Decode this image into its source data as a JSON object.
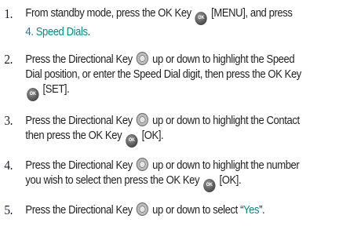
{
  "steps": [
    {
      "num": "1.",
      "line1_a": "From standby mode, press the OK Key",
      "line1_b": "[MENU], and press",
      "line2_link": "4. Speed Dials",
      "line2_end": "."
    },
    {
      "num": "2.",
      "line1_a": "Press the Directional Key",
      "line1_b": "up or down to highlight the Speed",
      "line2": "Dial position, or enter the Speed Dial digit, then press the OK Key",
      "line3": "[SET]."
    },
    {
      "num": "3.",
      "line1_a": "Press the Directional Key",
      "line1_b": "up or down to highlight the Contact",
      "line2_a": "then press the OK Key",
      "line2_b": "[OK]."
    },
    {
      "num": "4.",
      "line1_a": "Press the Directional Key",
      "line1_b": "up or down to highlight the number",
      "line2_a": "you wish to select then press the OK Key",
      "line2_b": "[OK]."
    },
    {
      "num": "5.",
      "line1_a": "Press the Directional Key",
      "line1_b": "up or down to select “",
      "line1_link": "Yes",
      "line1_end": "”."
    }
  ],
  "icons": {
    "ok_key_label": "OK"
  }
}
